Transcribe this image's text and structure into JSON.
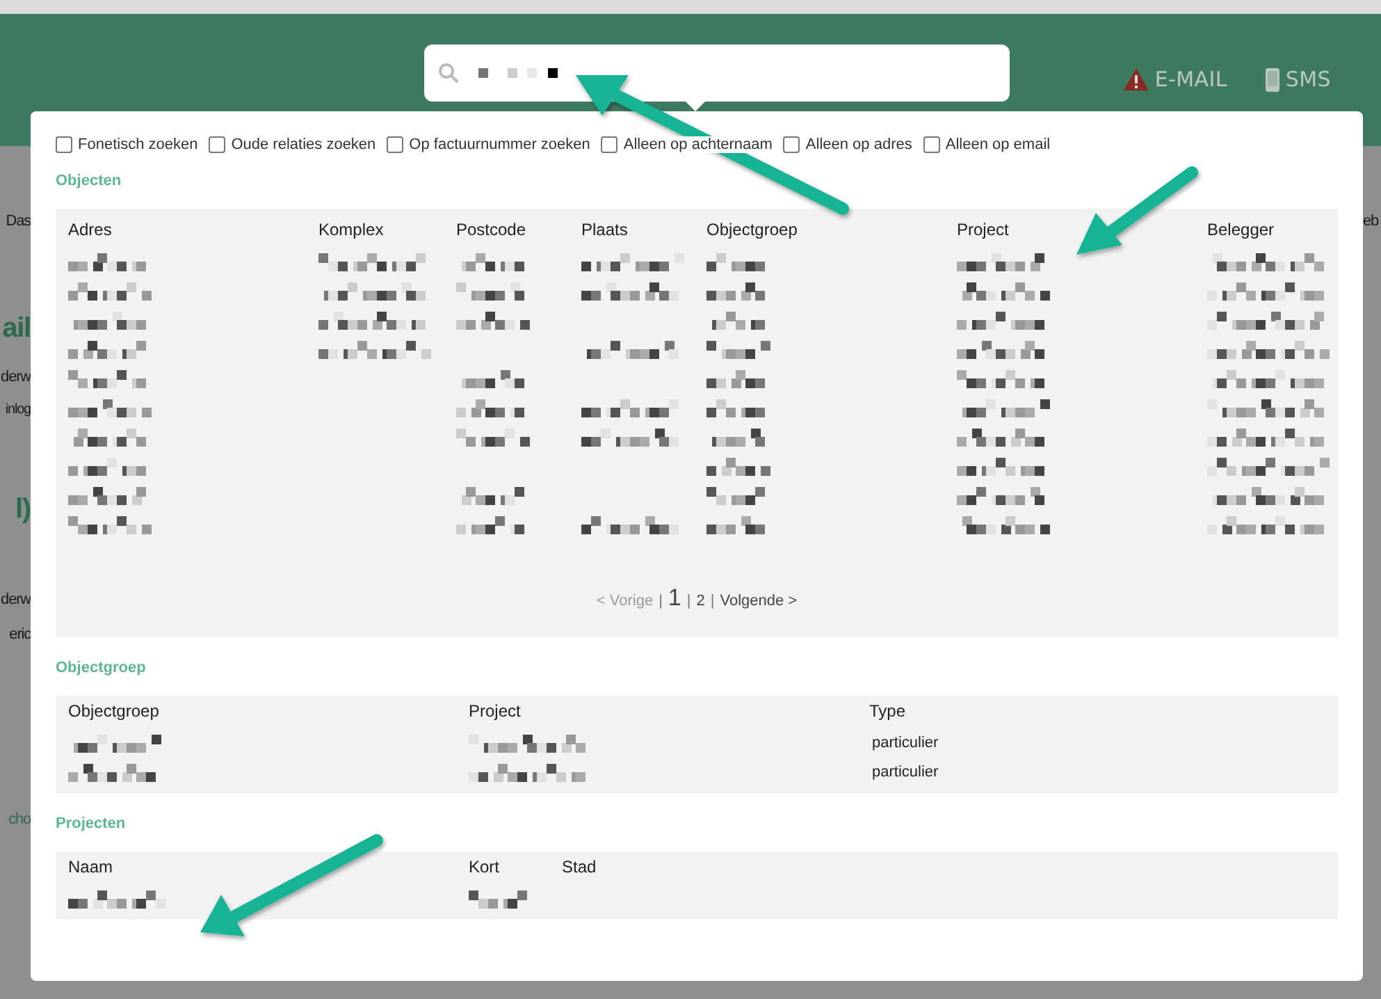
{
  "header": {
    "search": {
      "query": {
        "kind": "redacted"
      }
    },
    "alerts": [
      {
        "kind": "warning",
        "label": "E-MAIL"
      },
      {
        "kind": "phone",
        "label": "SMS"
      }
    ]
  },
  "background": {
    "left_fragments": [
      {
        "kind": "plain",
        "text": "Das"
      },
      {
        "kind": "heading",
        "text": "ail"
      },
      {
        "kind": "plain",
        "text": "derw"
      },
      {
        "kind": "small",
        "text": "inlog"
      },
      {
        "kind": "heading",
        "text": "l)"
      },
      {
        "kind": "plain",
        "text": "derw"
      },
      {
        "kind": "plain",
        "text": "eric"
      },
      {
        "kind": "link",
        "text": "cho"
      }
    ],
    "right_fragments": [
      {
        "kind": "plain",
        "text": "eb"
      }
    ]
  },
  "filters": [
    {
      "label": "Fonetisch zoeken",
      "checked": false
    },
    {
      "label": "Oude relaties zoeken",
      "checked": false
    },
    {
      "label": "Op factuurnummer zoeken",
      "checked": false
    },
    {
      "label": "Alleen op achternaam",
      "checked": false
    },
    {
      "label": "Alleen op adres",
      "checked": false
    },
    {
      "label": "Alleen op email",
      "checked": false
    }
  ],
  "sections": [
    {
      "title": "Objecten",
      "columns": [
        "Adres",
        "Komplex",
        "Postcode",
        "Plaats",
        "Objectgroep",
        "Project",
        "Belegger"
      ],
      "rows": [
        [
          {
            "kind": "redacted"
          },
          {
            "kind": "redacted"
          },
          {
            "kind": "redacted"
          },
          {
            "kind": "redacted"
          },
          {
            "kind": "redacted"
          },
          {
            "kind": "redacted"
          },
          {
            "kind": "redacted"
          }
        ],
        [
          {
            "kind": "redacted"
          },
          {
            "kind": "redacted"
          },
          {
            "kind": "redacted"
          },
          {
            "kind": "redacted"
          },
          {
            "kind": "redacted"
          },
          {
            "kind": "redacted"
          },
          {
            "kind": "redacted"
          }
        ],
        [
          {
            "kind": "redacted"
          },
          {
            "kind": "redacted"
          },
          {
            "kind": "redacted"
          },
          {
            "kind": "empty"
          },
          {
            "kind": "redacted"
          },
          {
            "kind": "redacted"
          },
          {
            "kind": "redacted"
          }
        ],
        [
          {
            "kind": "redacted"
          },
          {
            "kind": "redacted"
          },
          {
            "kind": "empty"
          },
          {
            "kind": "redacted"
          },
          {
            "kind": "redacted"
          },
          {
            "kind": "redacted"
          },
          {
            "kind": "redacted"
          }
        ],
        [
          {
            "kind": "redacted"
          },
          {
            "kind": "empty"
          },
          {
            "kind": "redacted"
          },
          {
            "kind": "empty"
          },
          {
            "kind": "redacted"
          },
          {
            "kind": "redacted"
          },
          {
            "kind": "redacted"
          }
        ],
        [
          {
            "kind": "redacted"
          },
          {
            "kind": "empty"
          },
          {
            "kind": "redacted"
          },
          {
            "kind": "redacted"
          },
          {
            "kind": "redacted"
          },
          {
            "kind": "redacted"
          },
          {
            "kind": "redacted"
          }
        ],
        [
          {
            "kind": "redacted"
          },
          {
            "kind": "empty"
          },
          {
            "kind": "redacted"
          },
          {
            "kind": "redacted"
          },
          {
            "kind": "redacted"
          },
          {
            "kind": "redacted"
          },
          {
            "kind": "redacted"
          }
        ],
        [
          {
            "kind": "redacted"
          },
          {
            "kind": "empty"
          },
          {
            "kind": "empty"
          },
          {
            "kind": "empty"
          },
          {
            "kind": "redacted"
          },
          {
            "kind": "redacted"
          },
          {
            "kind": "redacted"
          }
        ],
        [
          {
            "kind": "redacted"
          },
          {
            "kind": "empty"
          },
          {
            "kind": "redacted"
          },
          {
            "kind": "empty"
          },
          {
            "kind": "redacted"
          },
          {
            "kind": "redacted"
          },
          {
            "kind": "redacted"
          }
        ],
        [
          {
            "kind": "redacted"
          },
          {
            "kind": "empty"
          },
          {
            "kind": "redacted"
          },
          {
            "kind": "redacted"
          },
          {
            "kind": "redacted"
          },
          {
            "kind": "redacted"
          },
          {
            "kind": "redacted"
          }
        ]
      ],
      "pagination": {
        "previous": "< Vorige",
        "previous_disabled": true,
        "separator": "|",
        "pages": [
          {
            "label": "1",
            "selected": true
          },
          {
            "label": "2",
            "selected": false
          }
        ],
        "next": "Volgende >"
      }
    },
    {
      "title": "Objectgroep",
      "columns": [
        "Objectgroep",
        "Project",
        "Type"
      ],
      "rows": [
        [
          {
            "kind": "redacted"
          },
          {
            "kind": "redacted"
          },
          {
            "kind": "text",
            "text": "particulier"
          }
        ],
        [
          {
            "kind": "redacted"
          },
          {
            "kind": "redacted"
          },
          {
            "kind": "text",
            "text": "particulier"
          }
        ]
      ]
    },
    {
      "title": "Projecten",
      "columns": [
        "Naam",
        "Kort",
        "Stad"
      ],
      "rows": [
        [
          {
            "kind": "redacted"
          },
          {
            "kind": "redacted"
          },
          {
            "kind": "empty"
          }
        ]
      ]
    }
  ]
}
